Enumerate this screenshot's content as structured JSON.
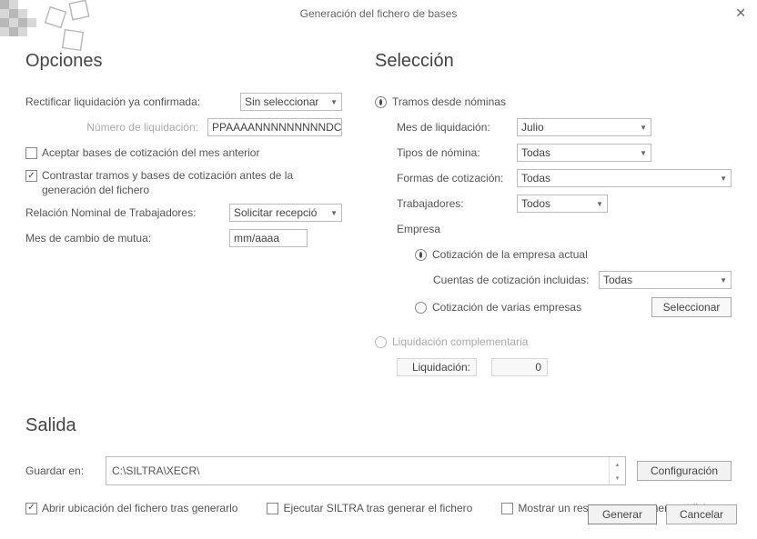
{
  "title": "Generación del fichero de bases",
  "opciones": {
    "heading": "Opciones",
    "rectificar_label": "Rectificar liquidación ya confirmada:",
    "rectificar_value": "Sin seleccionar",
    "num_liq_label": "Número de liquidación:",
    "num_liq_placeholder": "PPAAAANNNNNNNNNDC",
    "aceptar_bases": "Aceptar bases de cotización del mes anterior",
    "contrastar": "Contrastar tramos y bases de cotización antes de la generación del fichero",
    "rnt_label": "Relación Nominal de Trabajadores:",
    "rnt_value": "Solicitar recepció",
    "mes_mutua_label": "Mes de cambio de mutua:",
    "mes_mutua_placeholder": "mm/aaaa"
  },
  "seleccion": {
    "heading": "Selección",
    "tramos_label": "Tramos desde nóminas",
    "mes_liq_label": "Mes de liquidación:",
    "mes_liq_value": "Julio",
    "tipos_label": "Tipos de nómina:",
    "tipos_value": "Todas",
    "formas_label": "Formas de cotización:",
    "formas_value": "Todas",
    "trab_label": "Trabajadores:",
    "trab_value": "Todos",
    "empresa_label": "Empresa",
    "cot_actual": "Cotización de la empresa actual",
    "cuentas_label": "Cuentas de cotización incluidas:",
    "cuentas_value": "Todas",
    "cot_varias": "Cotización de varias empresas",
    "seleccionar_btn": "Seleccionar",
    "liq_comp": "Liquidación complementaria",
    "liq_label": "Liquidación:",
    "liq_value": "0"
  },
  "salida": {
    "heading": "Salida",
    "guardar_label": "Guardar en:",
    "guardar_value": "C:\\SILTRA\\XECR\\",
    "config_btn": "Configuración",
    "abrir_ubic": "Abrir ubicación del fichero tras generarlo",
    "ejecutar_siltra": "Ejecutar SILTRA tras generar el fichero",
    "mostrar_resumen": "Mostrar un resumen tras generar el fichero"
  },
  "footer": {
    "generar": "Generar",
    "cancelar": "Cancelar"
  }
}
